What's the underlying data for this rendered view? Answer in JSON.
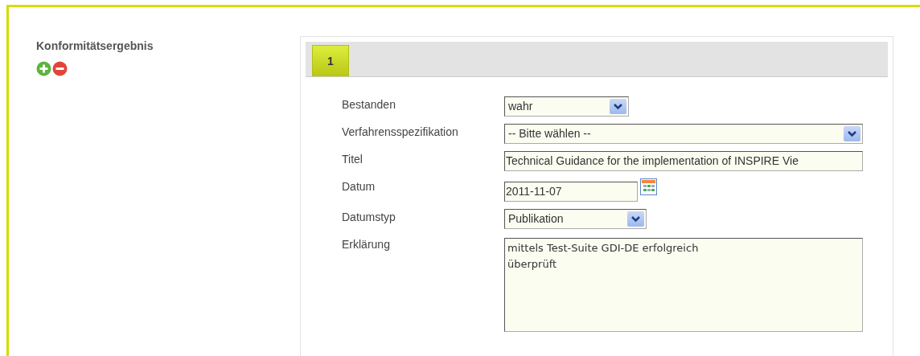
{
  "section": {
    "title": "Konformitätsergebnis"
  },
  "tabs": [
    {
      "label": "1",
      "selected": true
    }
  ],
  "fields": [
    {
      "label": "Bestanden",
      "kind": "select",
      "value": "wahr"
    },
    {
      "label": "Verfahrensspezifikation",
      "kind": "select",
      "value": "-- Bitte wählen --"
    },
    {
      "label": "Titel",
      "kind": "text",
      "value": "Technical Guidance for the implementation of INSPIRE Vie"
    },
    {
      "label": "Datum",
      "kind": "date",
      "value": "2011-11-07"
    },
    {
      "label": "Datumstyp",
      "kind": "select",
      "value": "Publikation"
    },
    {
      "label": "Erklärung",
      "kind": "textarea",
      "value": "mittels Test-Suite GDI-DE erfolgreich\nüberprüft"
    }
  ]
}
